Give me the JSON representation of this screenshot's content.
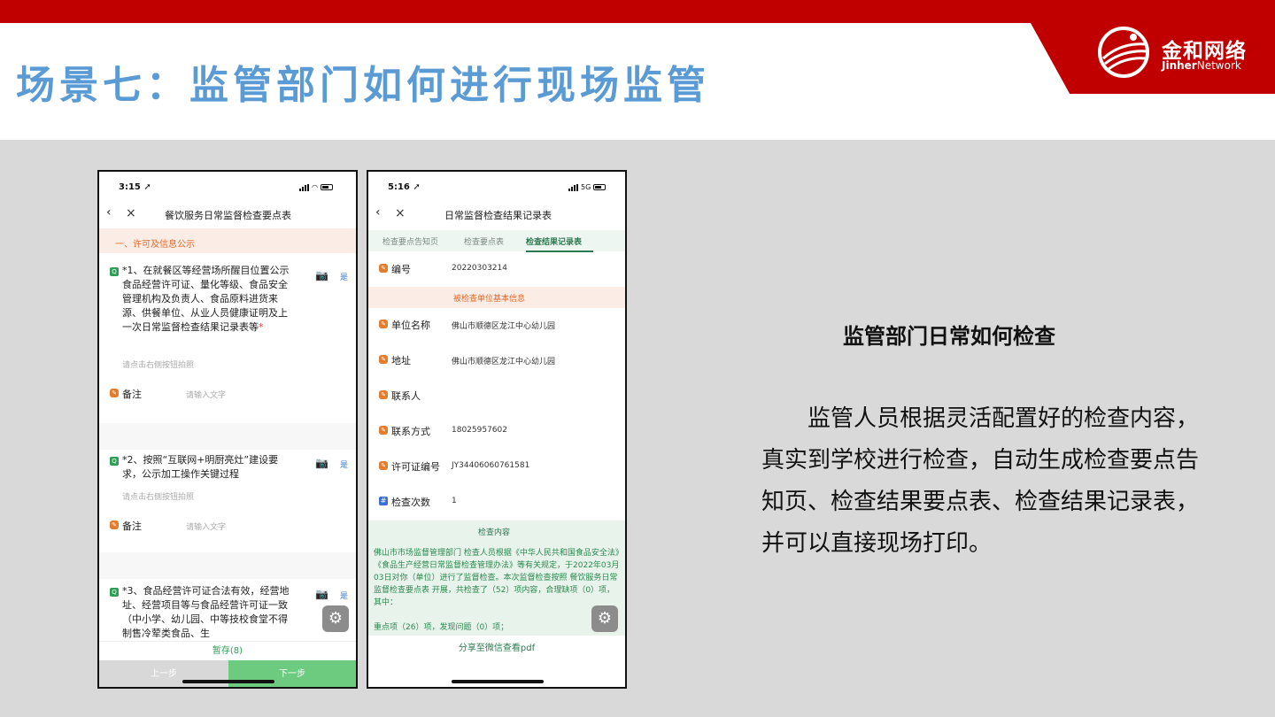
{
  "slide": {
    "title": "场景七：监管部门如何进行现场监管",
    "logo_cn": "金和网络",
    "logo_en_bold": "Jinher",
    "logo_en_rest": "Network",
    "colors": {
      "brand_red": "#c00000",
      "title_blue": "#5b9bd5",
      "green": "#2e9e57",
      "orange": "#e57c2c"
    }
  },
  "left_phone": {
    "status_time": "3:15 ➚",
    "nav_back": "‹",
    "nav_close": "×",
    "nav_title": "餐饮服务日常监督检查要点表",
    "section": "一、许可及信息公示",
    "questions": [
      {
        "icon": "Q",
        "text": "*1、在就餐区等经营场所醒目位置公示食品经营许可证、量化等级、食品安全管理机构及负责人、食品原料进货来源、供餐单位、从业人员健康证明及上一次日常监督检查结果记录表等",
        "required": "*",
        "hint": "请点击右侧按钮拍照",
        "answer": "是",
        "remark_label": "备注",
        "remark_placeholder": "请输入文字"
      },
      {
        "icon": "Q",
        "text": "*2、按照“互联网+明厨亮灶”建设要求，公示加工操作关键过程",
        "hint": "请点击右侧按钮拍照",
        "answer": "是",
        "remark_label": "备注",
        "remark_placeholder": "请输入文字"
      },
      {
        "icon": "Q",
        "text": "*3、食品经营许可证合法有效，经营地址、经营项目等与食品经营许可证一致（中小学、幼儿园、中等技校食堂不得制售冷荤类食品、生",
        "answer": "是"
      }
    ],
    "save_label": "暂存(8)",
    "prev_label": "上一步",
    "next_label": "下一步"
  },
  "right_phone": {
    "status_time": "5:16 ➚",
    "network": "5G",
    "nav_back": "‹",
    "nav_close": "×",
    "nav_title": "日常监督检查结果记录表",
    "tabs": [
      "检查要点告知页",
      "检查要点表",
      "检查结果记录表"
    ],
    "active_tab": 2,
    "serial_label": "编号",
    "serial_value": "20220303214",
    "sub_section": "被检查单位基本信息",
    "fields": [
      {
        "label": "单位名称",
        "value": "佛山市顺德区龙江中心幼儿园"
      },
      {
        "label": "地址",
        "value": "佛山市顺德区龙江中心幼儿园"
      },
      {
        "label": "联系人",
        "value": ""
      },
      {
        "label": "联系方式",
        "value": "18025957602"
      },
      {
        "label": "许可证编号",
        "value": "JY34406060761581"
      },
      {
        "label": "检查次数",
        "value": "1"
      }
    ],
    "content_title": "检查内容",
    "content_text": "佛山市市场监督管理部门 检查人员根据《中华人民共和国食品安全法》《食品生产经营日常监督检查管理办法》等有关规定，于2022年03月03日对你（单位）进行了监督检查。本次监督检查按照 餐饮服务日常监督检查要点表 开展，共检查了（52）项内容，合理缺项（0）项，其中：",
    "content_text2": "重点项（26）项，发现问题（0）项；",
    "share_label": "分享至微信查看pdf"
  },
  "side_text": {
    "heading": "监管部门日常如何检查",
    "paragraph": "监管人员根据灵活配置好的检查内容，真实到学校进行检查，自动生成检查要点告知页、检查结果要点表、检查结果记录表，并可以直接现场打印。"
  }
}
